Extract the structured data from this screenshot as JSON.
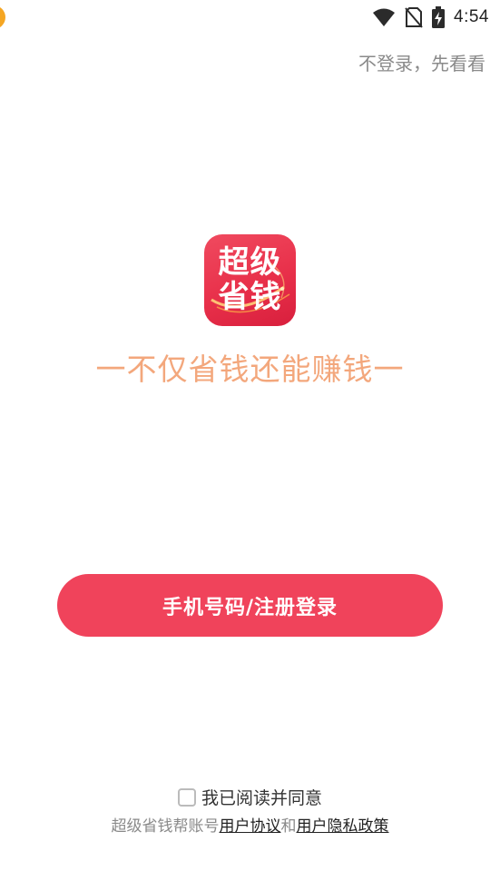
{
  "status_bar": {
    "time": "4:54"
  },
  "header": {
    "skip_label": "不登录，先看看"
  },
  "logo": {
    "line1": "超级",
    "line2": "省钱"
  },
  "slogan": "一不仅省钱还能赚钱一",
  "login_button": {
    "label": "手机号码/注册登录"
  },
  "agreement": {
    "checked": false,
    "label": "我已阅读并同意",
    "prefix": "超级省钱帮账号",
    "user_agreement": "用户协议",
    "conjunction": "和",
    "privacy_policy": "用户隐私政策"
  },
  "colors": {
    "brand": "#f0435b",
    "slogan": "#f3a77c",
    "muted": "#8a8a8a"
  },
  "icons": {
    "status": [
      "wifi-icon",
      "no-sim-icon",
      "battery-charging-icon"
    ]
  }
}
